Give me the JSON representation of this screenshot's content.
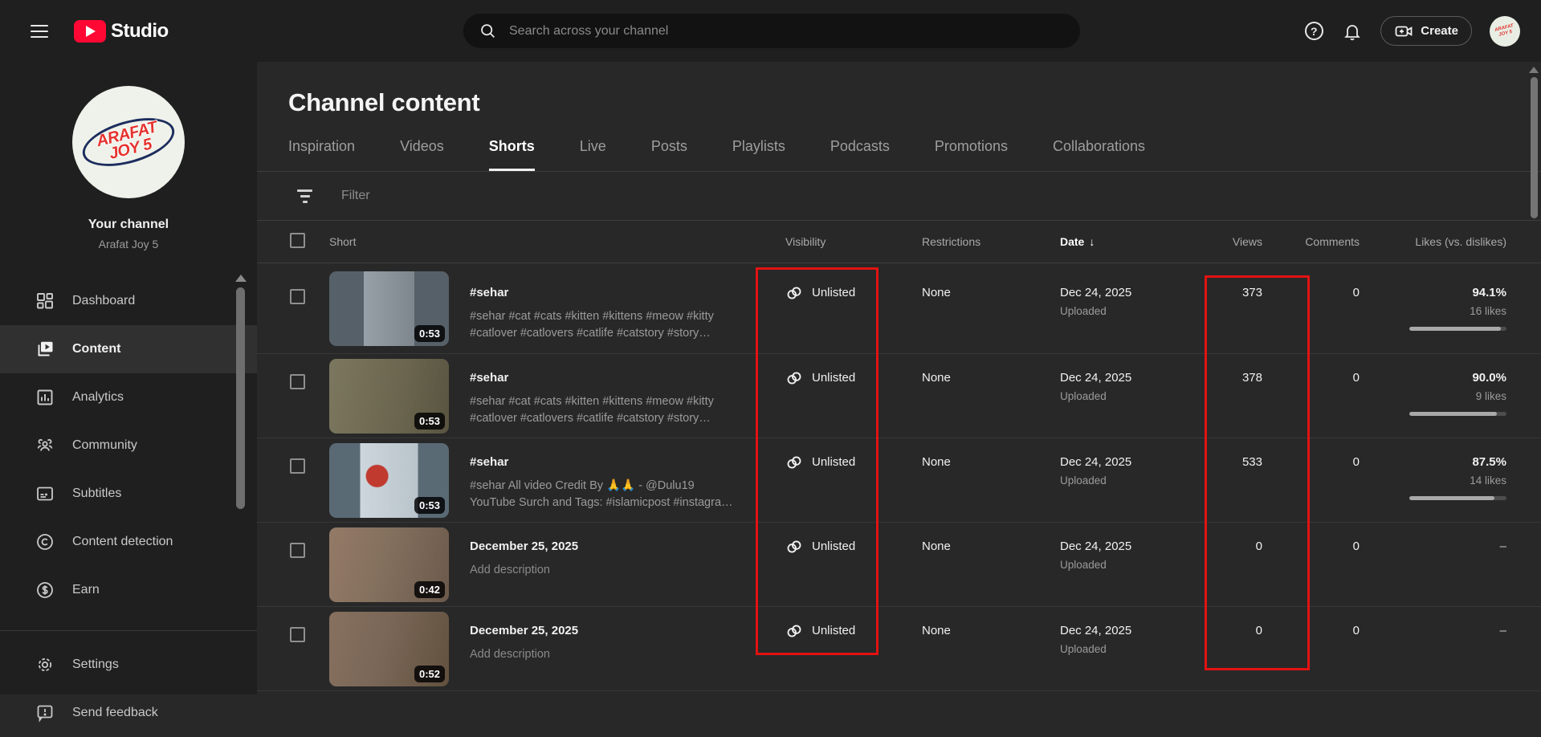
{
  "topbar": {
    "studio_label": "Studio",
    "search_placeholder": "Search across your channel",
    "create_label": "Create"
  },
  "sidebar": {
    "avatar_line1": "ARAFAT",
    "avatar_line2": "JOY 5",
    "your_channel_label": "Your channel",
    "channel_name": "Arafat Joy 5",
    "items": [
      {
        "label": "Dashboard"
      },
      {
        "label": "Content"
      },
      {
        "label": "Analytics"
      },
      {
        "label": "Community"
      },
      {
        "label": "Subtitles"
      },
      {
        "label": "Content detection"
      },
      {
        "label": "Earn"
      }
    ],
    "footer_items": [
      {
        "label": "Settings"
      },
      {
        "label": "Send feedback"
      }
    ]
  },
  "main": {
    "page_title": "Channel content",
    "tabs": [
      {
        "label": "Inspiration"
      },
      {
        "label": "Videos"
      },
      {
        "label": "Shorts",
        "active": true
      },
      {
        "label": "Live"
      },
      {
        "label": "Posts"
      },
      {
        "label": "Playlists"
      },
      {
        "label": "Podcasts"
      },
      {
        "label": "Promotions"
      },
      {
        "label": "Collaborations"
      }
    ],
    "filter_label": "Filter",
    "table": {
      "headers": {
        "short": "Short",
        "visibility": "Visibility",
        "restrictions": "Restrictions",
        "date": "Date",
        "sort_arrow": "↓",
        "views": "Views",
        "comments": "Comments",
        "likes": "Likes (vs. dislikes)"
      },
      "rows": [
        {
          "title": "#sehar",
          "desc1": "#sehar #cat #cats #kitten #kittens #meow #kitty",
          "desc2": "#catlover #catlovers #catlife #catstory #story…",
          "duration": "0:53",
          "visibility": "Unlisted",
          "restrictions": "None",
          "date": "Dec 24, 2025",
          "date_status": "Uploaded",
          "views": "373",
          "comments": "0",
          "like_pct": "94.1%",
          "like_count": "16 likes",
          "like_width": "94.1%",
          "thumb_bg": "linear-gradient(90deg,#566069 0%,#566069 29%,#97a0a8 29%,#7e868d 71%,#566069 71%)"
        },
        {
          "title": "#sehar",
          "desc1": "#sehar #cat #cats #kitten #kittens #meow #kitty",
          "desc2": "#catlover #catlovers #catlife #catstory #story…",
          "duration": "0:53",
          "visibility": "Unlisted",
          "restrictions": "None",
          "date": "Dec 24, 2025",
          "date_status": "Uploaded",
          "views": "378",
          "comments": "0",
          "like_pct": "90.0%",
          "like_count": "9 likes",
          "like_width": "90%",
          "thumb_bg": "linear-gradient(100deg,#7c775f 0%,#6a654e 60%,#585440 100%)"
        },
        {
          "title": "#sehar",
          "desc1": "#sehar All video Credit By 🙏🙏 - @Dulu19",
          "desc2": "YouTube Surch and Tags: #islamicpost #instagra…",
          "duration": "0:53",
          "visibility": "Unlisted",
          "restrictions": "None",
          "date": "Dec 24, 2025",
          "date_status": "Uploaded",
          "views": "533",
          "comments": "0",
          "like_pct": "87.5%",
          "like_count": "14 likes",
          "like_width": "87.5%",
          "thumb_bg": "radial-gradient(circle at 40% 44%, #c03a30 0 13%, rgba(0,0,0,0) 14%), linear-gradient(90deg,#5a6a75 0%,#5a6a75 26%,#cdd6dc 26%,#b9c4cb 74%,#5a6a75 74%)"
        },
        {
          "title": "December 25, 2025",
          "desc1": "Add description",
          "desc2": "",
          "duration": "0:42",
          "visibility": "Unlisted",
          "restrictions": "None",
          "date": "Dec 24, 2025",
          "date_status": "Uploaded",
          "views": "0",
          "comments": "0",
          "like_pct": "–",
          "like_count": "",
          "like_width": "0%",
          "thumb_bg": "linear-gradient(105deg,#937a66 0%,#84705e 45%,#6b594b 100%)"
        },
        {
          "title": "December 25, 2025",
          "desc1": "Add description",
          "desc2": "",
          "duration": "0:52",
          "visibility": "Unlisted",
          "restrictions": "None",
          "date": "Dec 24, 2025",
          "date_status": "Uploaded",
          "views": "0",
          "comments": "0",
          "like_pct": "–",
          "like_count": "",
          "like_width": "0%",
          "thumb_bg": "linear-gradient(105deg,#87705f 0%,#7a6757 45%,#62513f 100%)"
        }
      ]
    }
  },
  "annotations": {
    "box_color": "#e31212"
  }
}
